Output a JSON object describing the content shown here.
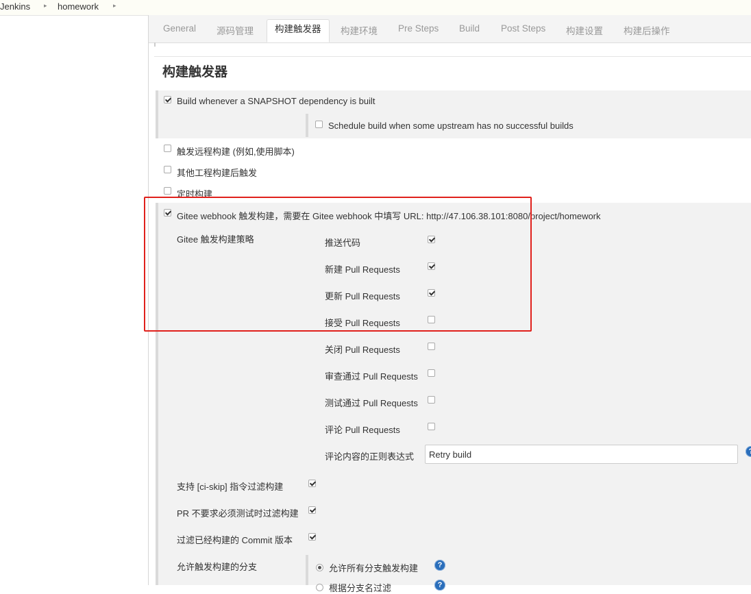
{
  "breadcrumb": {
    "items": [
      "Jenkins",
      "homework"
    ],
    "separator": "›"
  },
  "tabs": [
    {
      "label": "General",
      "active": false
    },
    {
      "label": "源码管理",
      "active": false
    },
    {
      "label": "构建触发器",
      "active": true
    },
    {
      "label": "构建环境",
      "active": false
    },
    {
      "label": "Pre Steps",
      "active": false
    },
    {
      "label": "Build",
      "active": false
    },
    {
      "label": "Post Steps",
      "active": false
    },
    {
      "label": "构建设置",
      "active": false
    },
    {
      "label": "构建后操作",
      "active": false
    }
  ],
  "section_title": "构建触发器",
  "triggers": [
    {
      "label": "Build whenever a SNAPSHOT dependency is built",
      "checked": true
    },
    {
      "label": "Schedule build when some upstream has no successful builds",
      "checked": false
    },
    {
      "label": "触发远程构建 (例如,使用脚本)",
      "checked": false
    },
    {
      "label": "其他工程构建后触发",
      "checked": false
    },
    {
      "label": "定时构建",
      "checked": false
    },
    {
      "label": "Gitee webhook 触发构建，需要在 Gitee webhook 中填写 URL: http://47.106.38.101:8080/project/homework",
      "checked": true
    }
  ],
  "gitee": {
    "strategy_label": "Gitee 触发构建策略",
    "strategies": [
      {
        "label": "推送代码",
        "checked": true
      },
      {
        "label": "新建 Pull Requests",
        "checked": true
      },
      {
        "label": "更新 Pull Requests",
        "checked": true
      },
      {
        "label": "接受 Pull Requests",
        "checked": false
      },
      {
        "label": "关闭 Pull Requests",
        "checked": false
      },
      {
        "label": "审查通过 Pull Requests",
        "checked": false
      },
      {
        "label": "测试通过 Pull Requests",
        "checked": false
      },
      {
        "label": "评论 Pull Requests",
        "checked": false
      }
    ],
    "comment_regex_label": "评论内容的正则表达式",
    "comment_regex_value": "Retry build",
    "options": [
      {
        "label": "支持 [ci-skip] 指令过滤构建",
        "checked": true
      },
      {
        "label": "PR 不要求必须测试时过滤构建",
        "checked": true
      },
      {
        "label": "过滤已经构建的 Commit 版本",
        "checked": true
      }
    ],
    "branches_label": "允许触发构建的分支",
    "branch_options": [
      {
        "label": "允许所有分支触发构建",
        "selected": true
      },
      {
        "label": "根据分支名过滤",
        "selected": false
      }
    ]
  },
  "colors": {
    "highlight": "#e0201b",
    "help_icon": "#2a6ebb"
  }
}
